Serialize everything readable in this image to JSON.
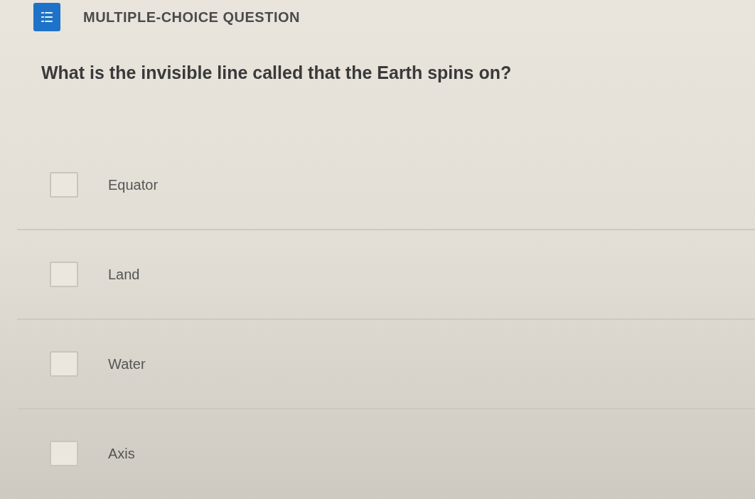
{
  "header": {
    "title": "MULTIPLE-CHOICE QUESTION"
  },
  "question": "What is the invisible line called that the Earth spins on?",
  "options": [
    {
      "label": "Equator",
      "checked": false
    },
    {
      "label": "Land",
      "checked": false
    },
    {
      "label": "Water",
      "checked": false
    },
    {
      "label": "Axis",
      "checked": false
    }
  ]
}
